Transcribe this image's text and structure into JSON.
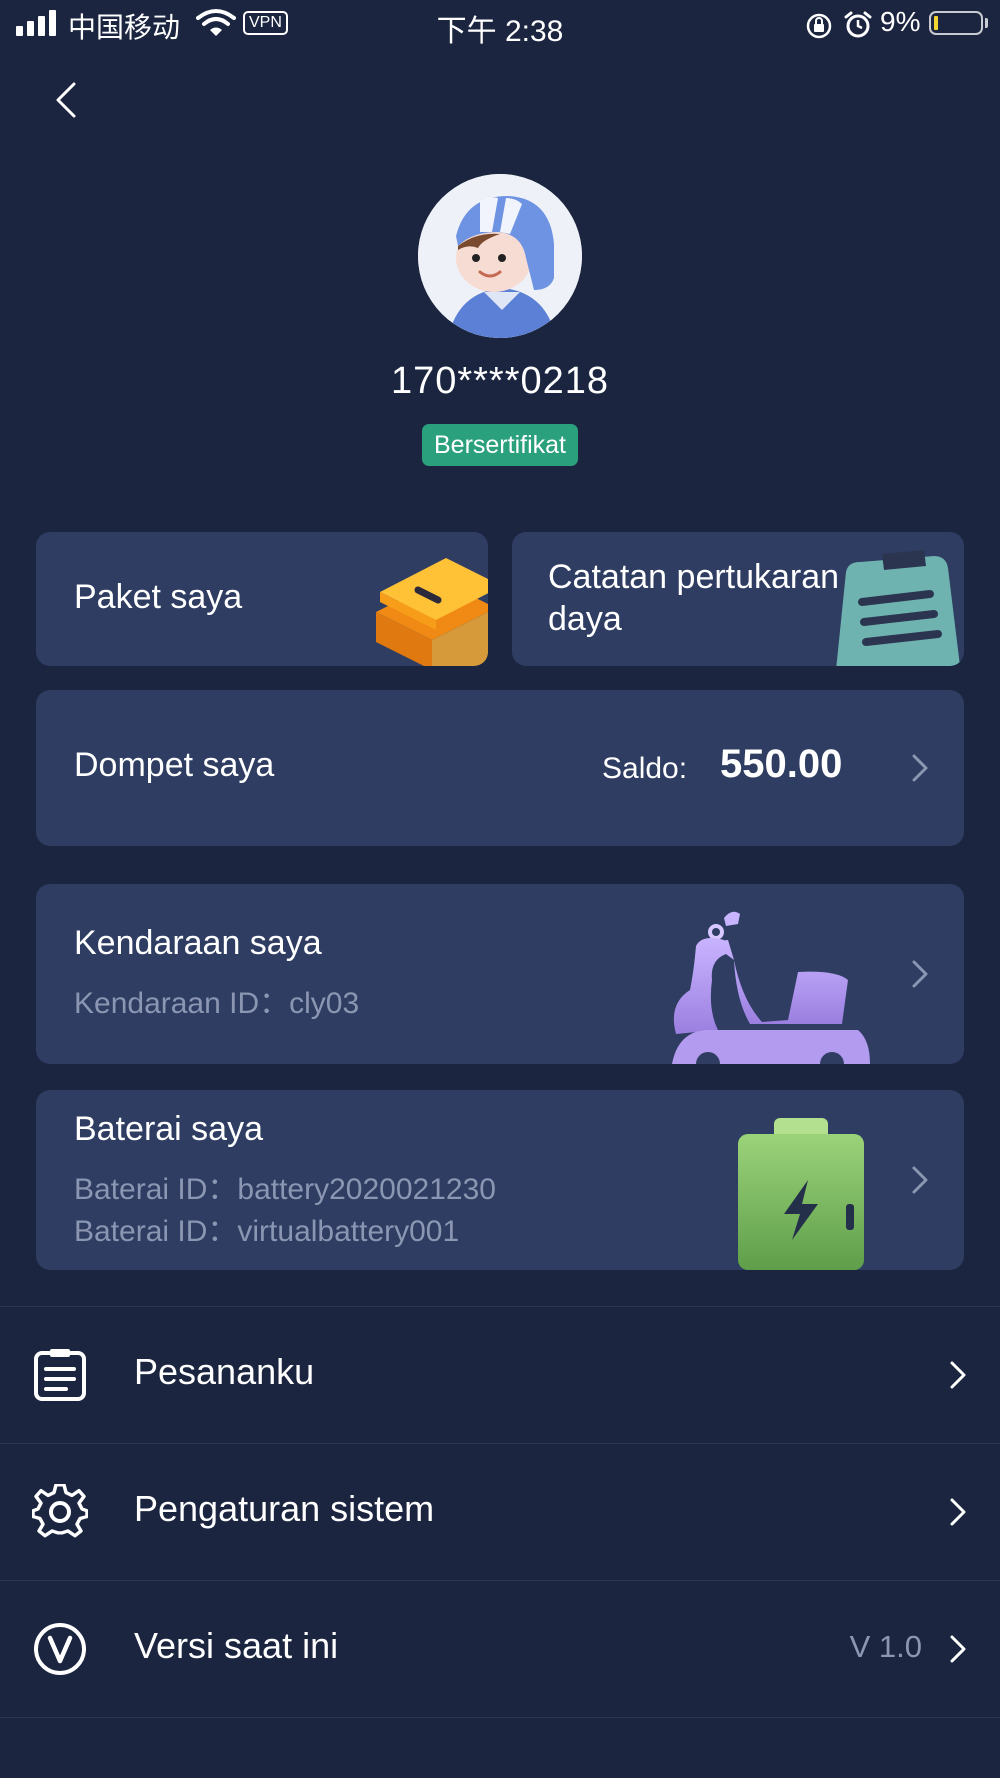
{
  "status_bar": {
    "carrier": "中国移动",
    "vpn": "VPN",
    "time": "下午 2:38",
    "battery_percent": "9%",
    "battery_level": 0.09
  },
  "profile": {
    "phone": "170****0218",
    "badge": "Bersertifikat"
  },
  "cards": {
    "package": {
      "label": "Paket saya"
    },
    "exchange_record": {
      "label": "Catatan pertukaran daya"
    },
    "wallet": {
      "label": "Dompet saya",
      "balance_label": "Saldo:",
      "balance_value": "550.00"
    },
    "vehicle": {
      "label": "Kendaraan saya",
      "id_line": "Kendaraan ID：cly03"
    },
    "battery": {
      "label": "Baterai saya",
      "id_lines": [
        "Baterai ID：battery2020021230",
        "Baterai ID：virtualbattery001"
      ]
    }
  },
  "menu": [
    {
      "label": "Pesananku",
      "icon": "orders-icon"
    },
    {
      "label": "Pengaturan sistem",
      "icon": "gear-icon"
    },
    {
      "label": "Versi saat ini",
      "icon": "version-icon",
      "value": "V 1.0"
    }
  ],
  "colors": {
    "background": "#1b2540",
    "card": "#2e3d61",
    "badge": "#2aa07d",
    "muted_text": "#8b96b3"
  }
}
